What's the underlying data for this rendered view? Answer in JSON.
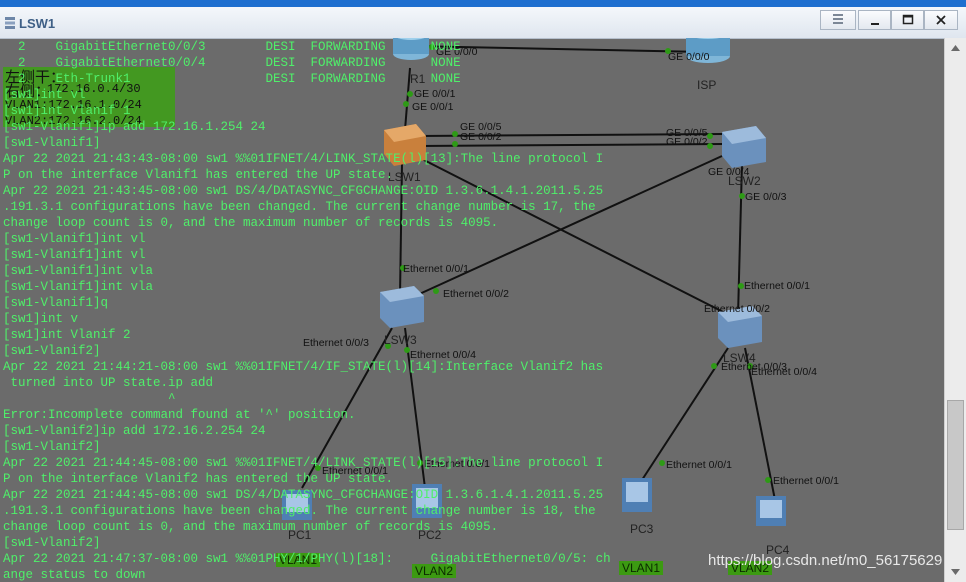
{
  "window": {
    "title": "LSW1",
    "controls": [
      "list-icon",
      "minimize-icon",
      "maximize-icon",
      "close-icon"
    ]
  },
  "topology": {
    "devices": {
      "r1": "R1",
      "isp": "ISP",
      "lsw1": "LSW1",
      "lsw2": "LSW2",
      "lsw3": "LSW3",
      "lsw4": "LSW4",
      "pc1": "PC1",
      "pc2": "PC2",
      "pc3": "PC3",
      "pc4": "PC4"
    },
    "ports": {
      "r1_isp": "GE 0/0/0",
      "isp_r1": "GE 0/0/0",
      "r1_down": "GE 0/0/1",
      "lsw1_up": "GE 0/0/1",
      "lsw1_p5": "GE 0/0/5",
      "lsw1_p2": "GE 0/0/2",
      "lsw2_p5": "GE 0/0/5",
      "lsw2_p2": "GE 0/0/2",
      "lsw2_p4": "GE 0/0/4",
      "lsw1_p3": "GE 0/0/3",
      "lsw1_p4": "GE 0/0/4",
      "lsw2_p3": "GE 0/0/3",
      "lsw3_e1": "Ethernet 0/0/1",
      "lsw3_e2": "Ethernet 0/0/2",
      "lsw3_e3": "Ethernet 0/0/3",
      "lsw3_e4": "Ethernet 0/0/4",
      "lsw4_e1": "Ethernet 0/0/1",
      "lsw4_e2": "Ethernet 0/0/2",
      "lsw4_e3": "Ethernet 0/0/3",
      "lsw4_e4": "Ethernet 0/0/4",
      "pc1_e": "Ethernet 0/0/1",
      "pc2_e": "Ethernet 0/0/1",
      "pc3_e": "Ethernet 0/0/1",
      "pc4_e": "Ethernet 0/0/1"
    },
    "vlan_tags": {
      "pc1": "VLAN1",
      "pc2": "VLAN2",
      "pc3": "VLAN1",
      "pc4": "VLAN2"
    },
    "notes": {
      "left_top": "左侧干：",
      "left_2": "右侧："
    }
  },
  "terminal": {
    "lines": [
      "  2    GigabitEthernet0/0/3        DESI  FORWARDING      NONE",
      "  2    GigabitEthernet0/0/4        DESI  FORWARDING      NONE",
      "  2    Eth-Trunk1                  DESI  FORWARDING      NONE",
      "[sw1]int vl",
      "[sw1]int Vlanif 1",
      "[sw1-Vlanif1]ip add 172.16.1.254 24",
      "[sw1-Vlanif1]",
      "Apr 22 2021 21:43:43-08:00 sw1 %%01IFNET/4/LINK_STATE(l)[13]:The line protocol I",
      "P on the interface Vlanif1 has entered the UP state.",
      "Apr 22 2021 21:43:45-08:00 sw1 DS/4/DATASYNC_CFGCHANGE:OID 1.3.6.1.4.1.2011.5.25",
      ".191.3.1 configurations have been changed. The current change number is 17, the",
      "change loop count is 0, and the maximum number of records is 4095.",
      "[sw1-Vlanif1]int vl",
      "[sw1-Vlanif1]int vl",
      "[sw1-Vlanif1]int vla",
      "[sw1-Vlanif1]int vla",
      "[sw1-Vlanif1]q",
      "[sw1]int v",
      "[sw1]int Vlanif 2",
      "[sw1-Vlanif2]",
      "Apr 22 2021 21:44:21-08:00 sw1 %%01IFNET/4/IF_STATE(l)[14]:Interface Vlanif2 has",
      " turned into UP state.ip add",
      "                      ^",
      "Error:Incomplete command found at '^' position.",
      "[sw1-Vlanif2]ip add 172.16.2.254 24",
      "[sw1-Vlanif2]",
      "Apr 22 2021 21:44:45-08:00 sw1 %%01IFNET/4/LINK_STATE(l)[15]:The line protocol I",
      "P on the interface Vlanif2 has entered the UP state.",
      "Apr 22 2021 21:44:45-08:00 sw1 DS/4/DATASYNC_CFGCHANGE:OID 1.3.6.1.4.1.2011.5.25",
      ".191.3.1 configurations have been changed. The current change number is 18, the",
      "change loop count is 0, and the maximum number of records is 4095.",
      "[sw1-Vlanif2]",
      "Apr 22 2021 21:47:37-08:00 sw1 %%01PHY/1/PHY(l)[18]:     GigabitEthernet0/0/5: ch",
      "ange status to down"
    ],
    "overlay_lines": [
      "172.16.0.4/30",
      "VLAN1:172.16.1.0/24",
      "VLAN2:172.16.2.0/24"
    ]
  },
  "watermark": "https://blog.csdn.net/m0_56175629",
  "colors": {
    "terminal_text": "#4ff06a",
    "background": "#6b6b6b",
    "link": "#111111",
    "port_dot": "#2e9a16",
    "vlan_tag": "#3c9a12"
  }
}
